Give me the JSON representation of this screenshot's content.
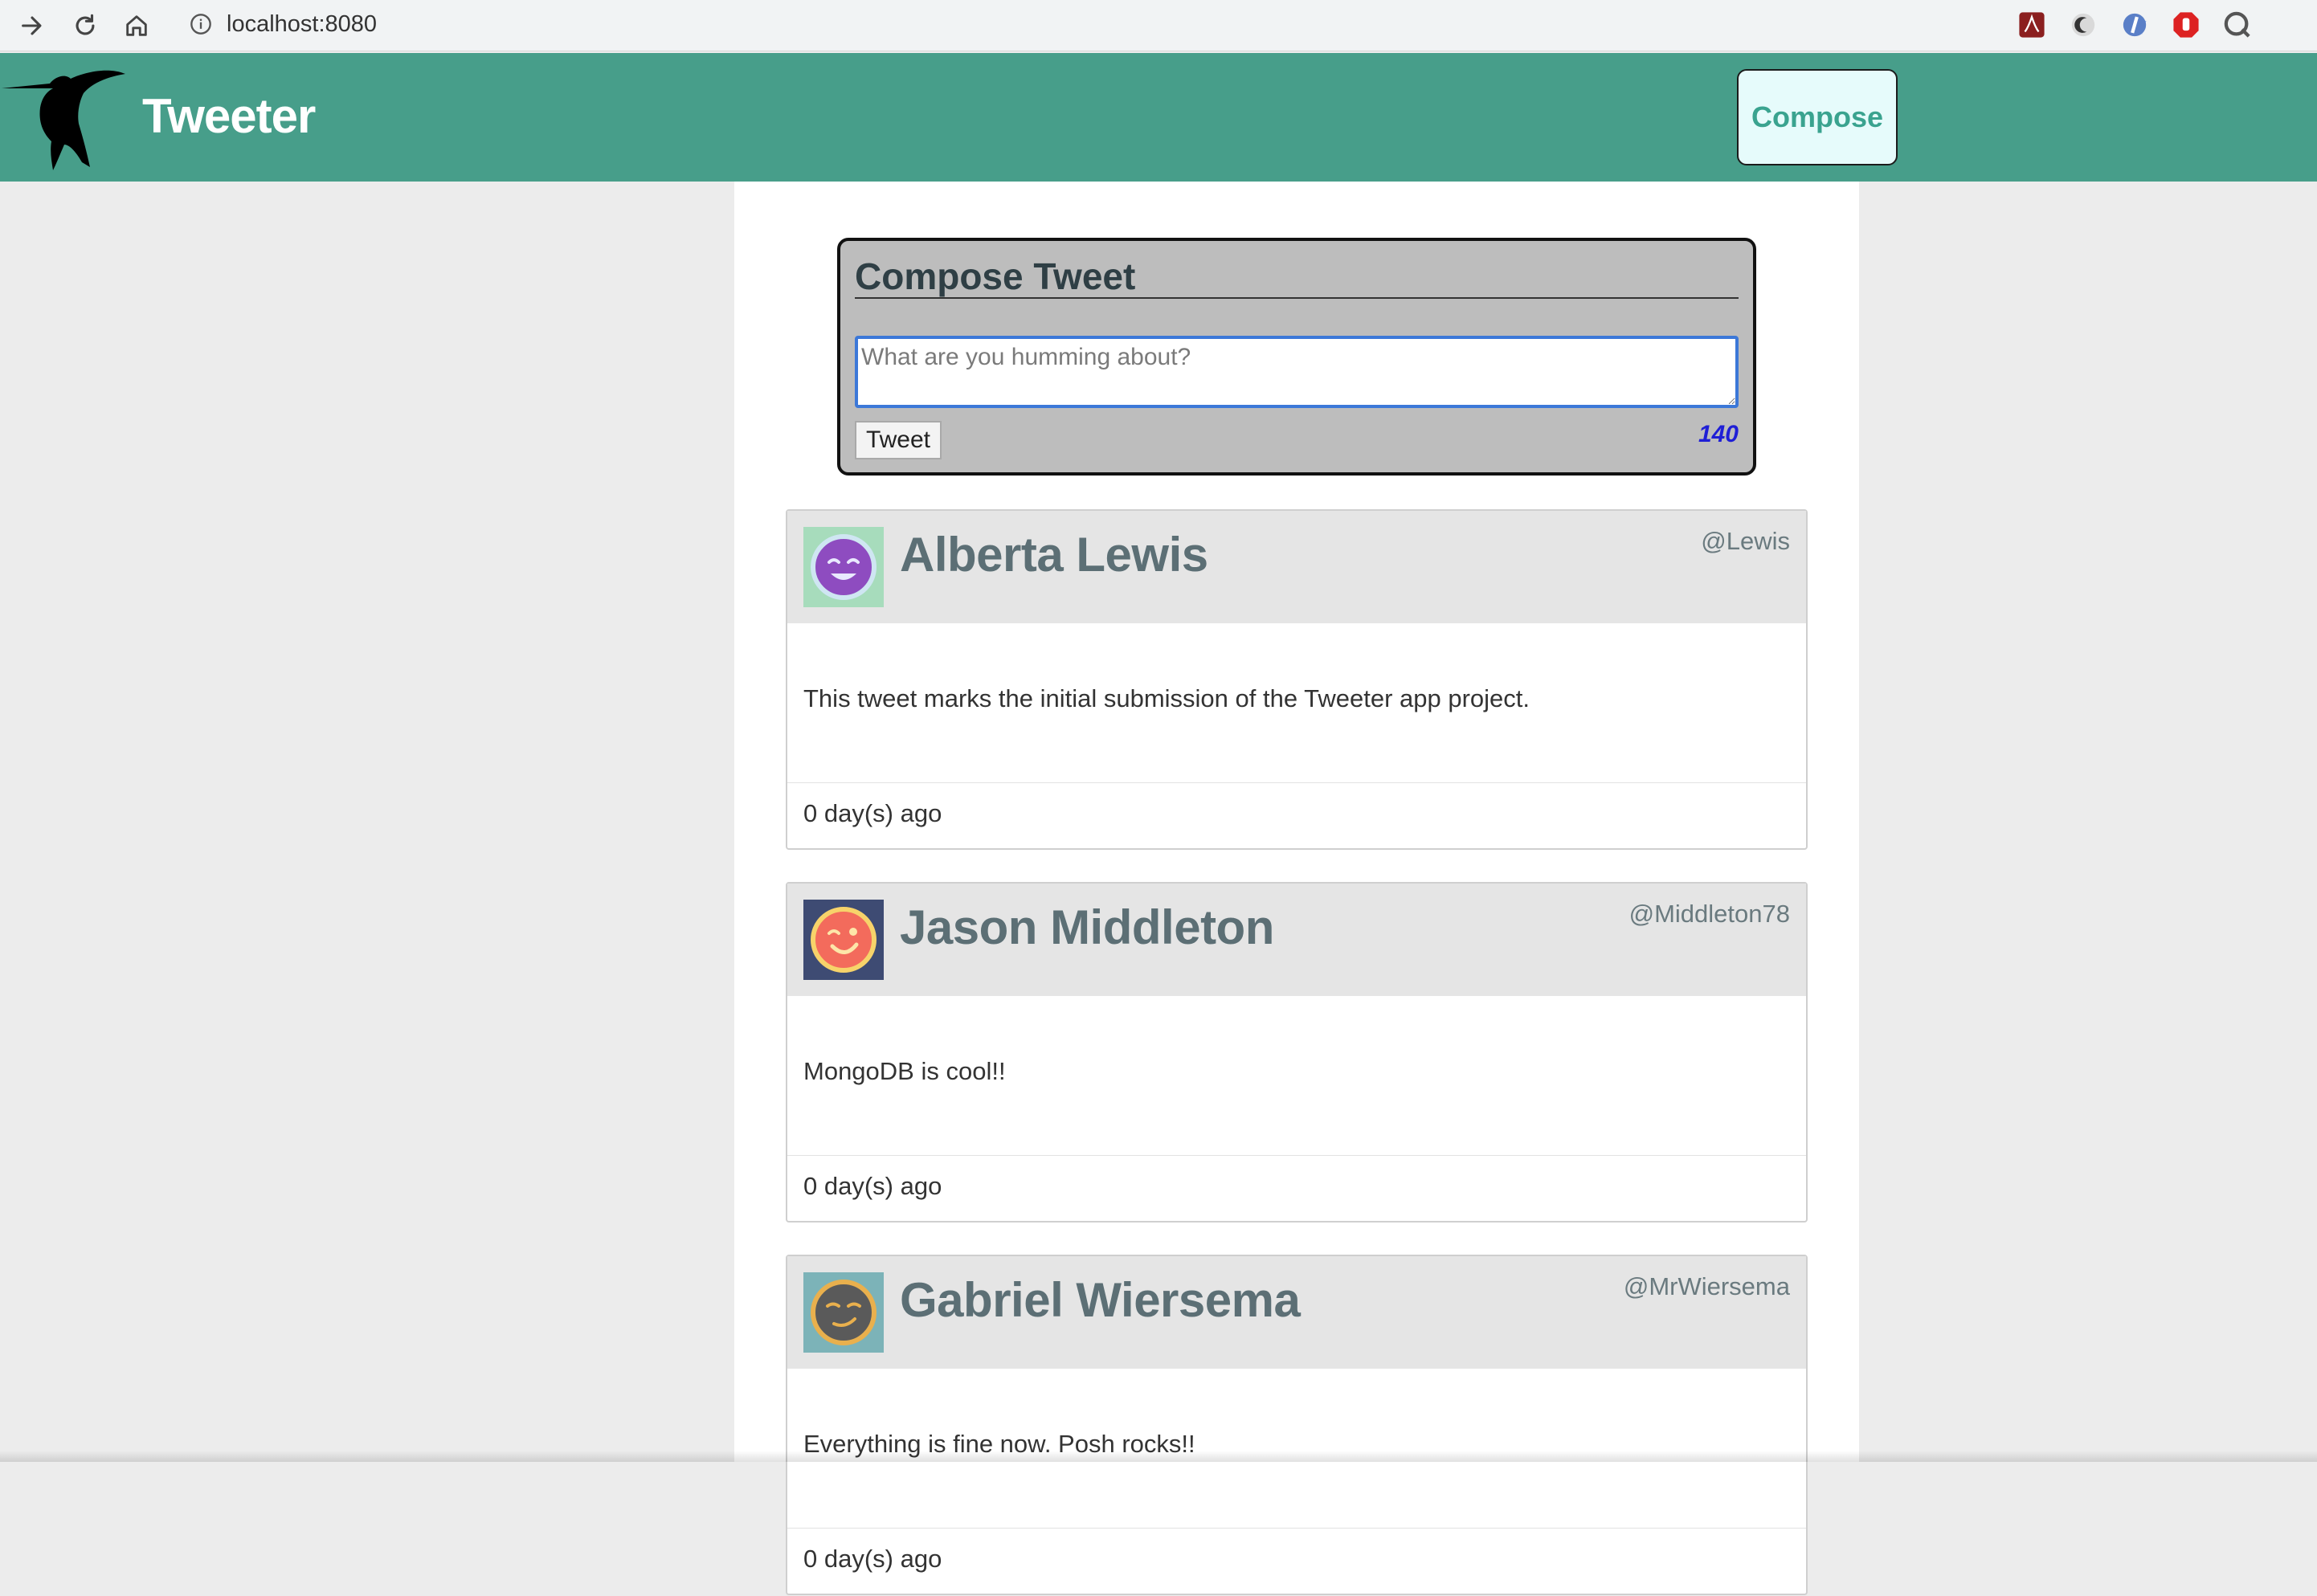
{
  "browser": {
    "url": "localhost:8080",
    "icons": [
      "forward-icon",
      "reload-icon",
      "home-icon",
      "info-icon",
      "star-icon"
    ],
    "extensions": [
      "pdf-extension-icon",
      "dark-mode-extension-icon",
      "blue-extension-icon",
      "red-shield-extension-icon",
      "gray-extension-icon"
    ]
  },
  "header": {
    "brand": "Tweeter",
    "compose_button": "Compose",
    "color": "#479e8a"
  },
  "compose": {
    "title": "Compose Tweet",
    "placeholder": "What are you humming about?",
    "submit_label": "Tweet",
    "counter": "140"
  },
  "tweets": [
    {
      "name": "Alberta Lewis",
      "handle": "@Lewis",
      "content": "This tweet marks the initial submission of the Tweeter app project.",
      "time": "0 day(s) ago",
      "avatar_bg": "#a7dcbc",
      "avatar_face": "#8e4cc0"
    },
    {
      "name": "Jason Middleton",
      "handle": "@Middleton78",
      "content": "MongoDB is cool!!",
      "time": "0 day(s) ago",
      "avatar_bg": "#3e4b73",
      "avatar_face": "#f36b5c"
    },
    {
      "name": "Gabriel Wiersema",
      "handle": "@MrWiersema",
      "content": "Everything is fine now. Posh rocks!!",
      "time": "0 day(s) ago",
      "avatar_bg": "#7cb3b8",
      "avatar_face": "#e9b04d"
    }
  ]
}
